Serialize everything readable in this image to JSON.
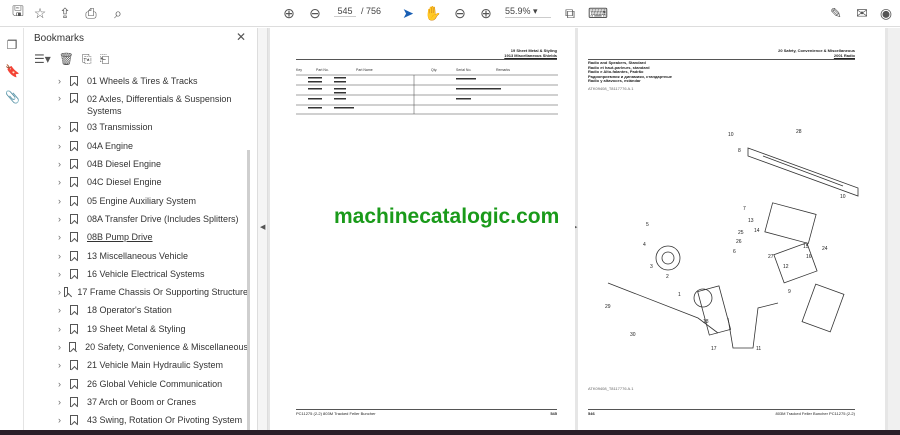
{
  "toolbar": {
    "icons": [
      "save-icon",
      "star-icon",
      "upload-icon",
      "print-icon",
      "search-icon",
      "page-up-icon",
      "page-down-icon",
      "select-arrow-icon",
      "hand-icon",
      "zoom-out-icon",
      "zoom-in-icon",
      "fit-page-icon",
      "keyboard-scroll-icon",
      "sign-icon",
      "mail-icon",
      "account-icon"
    ],
    "page_current": "545",
    "page_total": "/ 756",
    "zoom": "55.9%"
  },
  "bookmarks": {
    "title": "Bookmarks",
    "items": [
      "01 Wheels & Tires & Tracks",
      "02 Axles, Differentials & Suspension Systems",
      "03 Transmission",
      "04A Engine",
      "04B Diesel Engine",
      "04C Diesel Engine",
      "05 Engine Auxiliary System",
      "08A Transfer Drive (Includes Splitters)",
      "08B Pump Drive",
      "13 Miscellaneous Vehicle",
      "16 Vehicle Electrical Systems",
      "17 Frame Chassis Or Supporting Structure",
      "18 Operator's Station",
      "19 Sheet Metal & Styling",
      "20 Safety, Convenience & Miscellaneous",
      "21 Vehicle Main Hydraulic System",
      "26 Global Vehicle Communication",
      "37 Arch or Boom or Cranes",
      "43 Swing, Rotation Or Pivoting System"
    ]
  },
  "page_left": {
    "header1": "19 Sheet Metal & Styling",
    "header2": "1913 Miscellaneous Shields",
    "cols": [
      "Key",
      "Part No.",
      "Part Name",
      "Qty.",
      "Serial No.",
      "Remarks"
    ],
    "footer": "PC11275 (2-2) 803M Tracked Feller Buncher",
    "page_no": "545"
  },
  "page_right": {
    "header1": "20 Safety, Convenience & Miscellaneous",
    "header2": "2001 Radio",
    "titles": [
      "Radio and Speakers, Standard",
      "Radio et haut-parleurs, standard",
      "Radio e Alto-falantes, Padrão",
      "Радиоприемник и динамики, стандартные",
      "Radio y altavoces, estándar"
    ],
    "fig": "ATK09408_T8117776 A.1",
    "footer": "803M Tracked Feller Buncher PC11275 (2-2)",
    "page_no": "546",
    "callouts": [
      "10",
      "28",
      "8",
      "10",
      "7",
      "13",
      "14",
      "15",
      "16",
      "24",
      "5",
      "4",
      "3",
      "2",
      "1",
      "12",
      "27",
      "26",
      "25",
      "6",
      "9",
      "29",
      "30",
      "18",
      "17",
      "11"
    ]
  },
  "watermark": "machinecatalogic.com"
}
